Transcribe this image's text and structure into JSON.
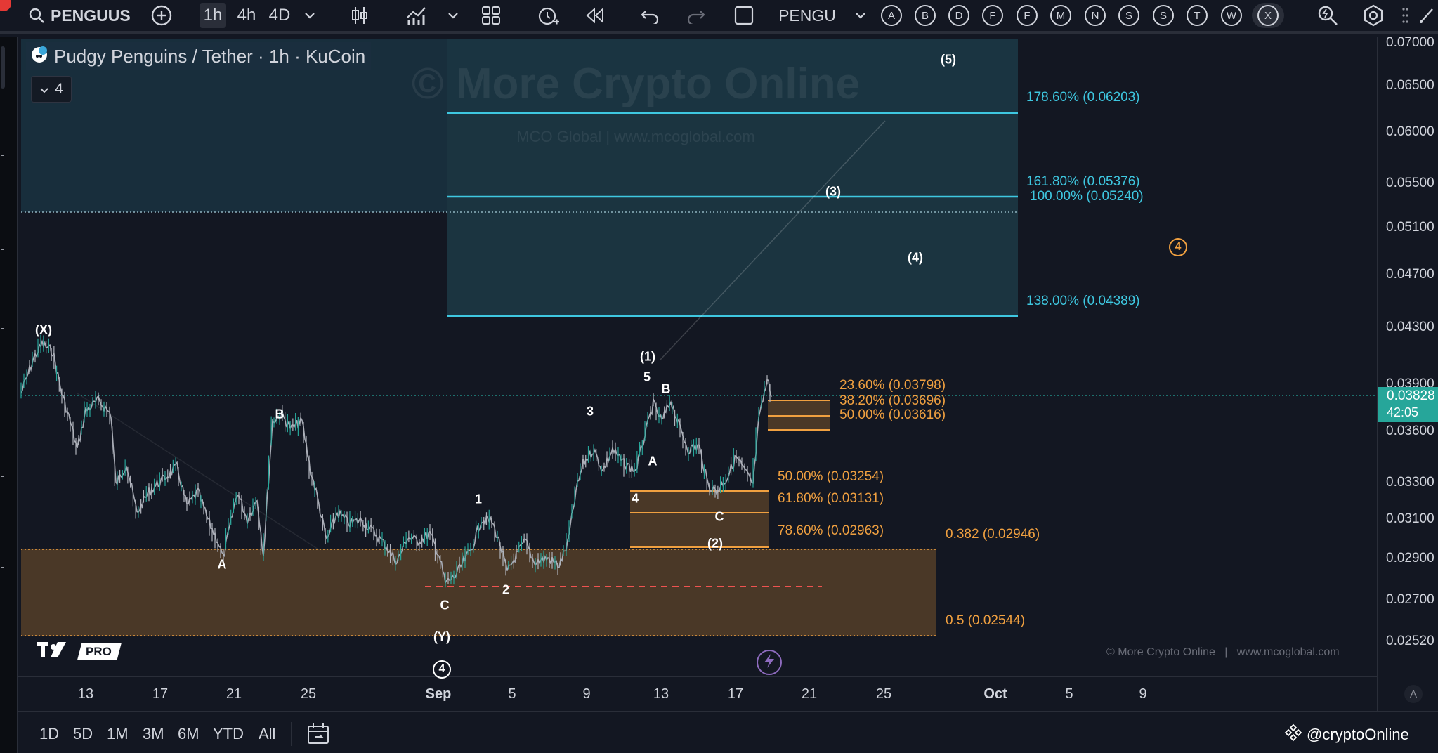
{
  "toolbar": {
    "search_value": "PENGUUS",
    "timeframes": [
      "1h",
      "4h",
      "4D"
    ],
    "active_timeframe": "1h",
    "compare_label": "PENGU",
    "letter_buttons": [
      "A",
      "B",
      "D",
      "F",
      "F",
      "M",
      "N",
      "S",
      "S",
      "T",
      "W",
      "X"
    ]
  },
  "legend": {
    "title": "Pudgy Penguins / Tether · 1h · KuCoin",
    "indicator_count": "4"
  },
  "price_axis": {
    "labels": [
      "0.07000",
      "0.06500",
      "0.06000",
      "0.05500",
      "0.05100",
      "0.04700",
      "0.04300",
      "0.03900",
      "0.03600",
      "0.03300",
      "0.03100",
      "0.02900",
      "0.02700",
      "0.02520"
    ],
    "current_price": "0.03828",
    "countdown": "42:05"
  },
  "time_axis": {
    "labels": [
      "13",
      "17",
      "21",
      "25",
      "Sep",
      "5",
      "9",
      "13",
      "17",
      "21",
      "25",
      "Oct",
      "5",
      "9"
    ]
  },
  "waves": {
    "X": "(X)",
    "A1": "A",
    "B1": "B",
    "C1": "C",
    "Y": "(Y)",
    "w4_circle": "4",
    "i1": "1",
    "i2": "2",
    "i3": "3",
    "i4": "4",
    "i5": "5",
    "p1": "(1)",
    "B2": "B",
    "A2": "A",
    "C2": "C",
    "p2": "(2)",
    "p3": "(3)",
    "p4": "(4)",
    "p5": "(5)",
    "w4_circle_future": "4"
  },
  "fib_targets": {
    "f1786": "178.60% (0.06203)",
    "f1618": "161.80% (0.05376)",
    "f100": "100.00% (0.05240)",
    "f138": "138.00% (0.04389)"
  },
  "fib_retrace_small": {
    "f236": "23.60% (0.03798)",
    "f382": "38.20% (0.03696)",
    "f50": "50.00% (0.03616)"
  },
  "fib_retrace_mid": {
    "f50": "50.00% (0.03254)",
    "f618": "61.80% (0.03131)",
    "f786": "78.60% (0.02963)"
  },
  "fib_support": {
    "f382": "0.382 (0.02946)",
    "f05": "0.5 (0.02544)"
  },
  "watermark": {
    "big": "© More Crypto Online",
    "small": "MCO Global   |   www.mcoglobal.com",
    "footer": "© More Crypto Online   |   www.mcoglobal.com"
  },
  "brand": {
    "pro": "PRO"
  },
  "ranges": [
    "1D",
    "5D",
    "1M",
    "3M",
    "6M",
    "YTD",
    "All"
  ],
  "auto_label": "A",
  "footer_credit": "@cryptoOnline",
  "colors": {
    "bg": "#131722",
    "teal": "#26c6da",
    "orange": "#f0a040",
    "up": "#26a69a",
    "down": "#ef5350",
    "candle": "#b2b5be"
  }
}
